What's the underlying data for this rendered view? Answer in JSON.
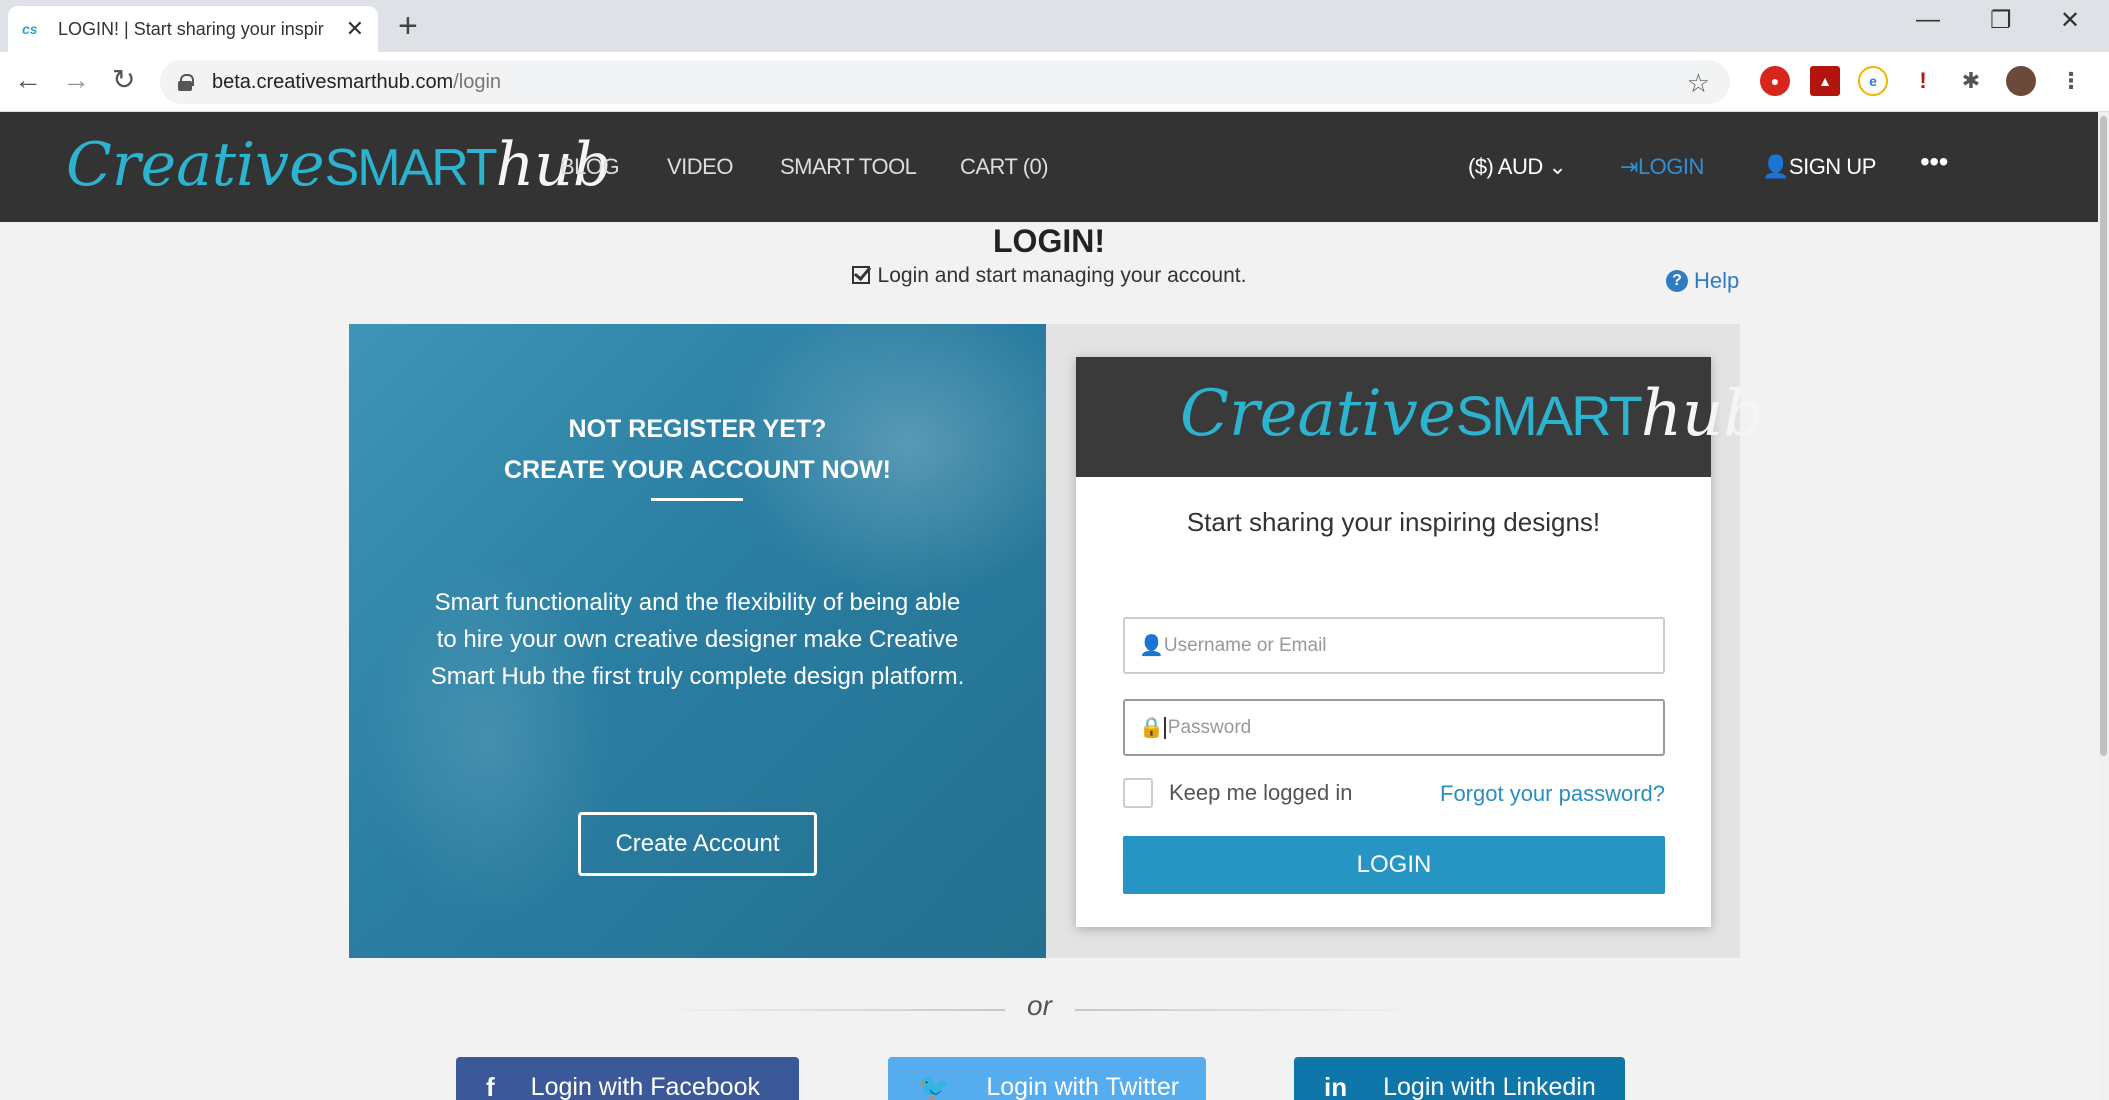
{
  "browser": {
    "tab_title": "LOGIN! | Start sharing your inspir",
    "new_tab": "+",
    "url_domain": "beta.creativesmarthub.com",
    "url_path": "/login"
  },
  "header": {
    "logo_script": "Creative",
    "logo_smart": "SMART",
    "logo_hub": "hub",
    "nav": {
      "blog": "BLOG",
      "video": "VIDEO",
      "smart_tool": "SMART TOOL",
      "cart": "CART (0)",
      "currency": "($) AUD",
      "login": "LOGIN",
      "signup": "SIGN UP"
    }
  },
  "page": {
    "title": "LOGIN!",
    "subtitle": "Login and start managing your account.",
    "help": "Help"
  },
  "promo": {
    "heading_line1": "NOT REGISTER YET?",
    "heading_line2": "CREATE YOUR ACCOUNT NOW!",
    "text": "Smart functionality and the flexibility of being able to hire your own creative designer make Creative Smart Hub the first truly complete design platform.",
    "button": "Create Account"
  },
  "login_form": {
    "tagline": "Start sharing your inspiring designs!",
    "username_placeholder": "Username or Email",
    "password_placeholder": "Password",
    "remember_label": "Keep me logged in",
    "forgot_link": "Forgot your password?",
    "submit": "LOGIN"
  },
  "divider": {
    "text": "or"
  },
  "social": {
    "facebook": "Login with Facebook",
    "twitter": "Login with Twitter",
    "linkedin": "Login with Linkedin"
  },
  "colors": {
    "header_bg": "#333333",
    "accent": "#2795c4",
    "facebook": "#3b5998",
    "twitter": "#55acee",
    "linkedin": "#0e76a8"
  }
}
